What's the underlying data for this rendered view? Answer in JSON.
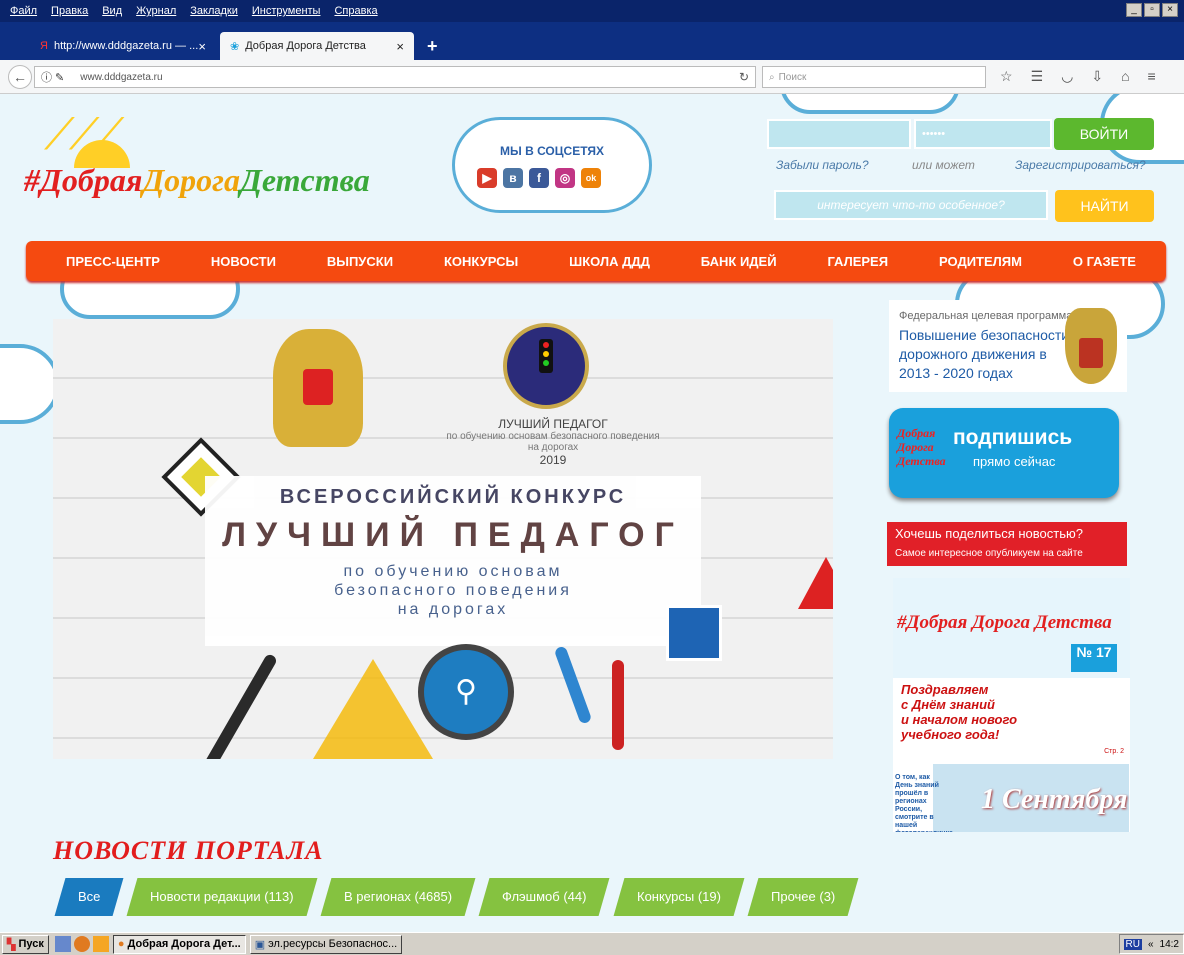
{
  "browser_menu": [
    "Файл",
    "Правка",
    "Вид",
    "Журнал",
    "Закладки",
    "Инструменты",
    "Справка"
  ],
  "tabs": [
    {
      "label": "http://www.dddgazeta.ru — ...",
      "close": "×"
    },
    {
      "label": "Добрая Дорога Детства",
      "close": "×"
    }
  ],
  "newtab": "+",
  "window_buttons": [
    "_",
    "▫",
    "×"
  ],
  "url": "www.dddgazeta.ru",
  "browser_search_placeholder": "Поиск",
  "site": {
    "logo_text": {
      "p1": "#Добрая",
      "p2": "Дорога",
      "p3": "Детства"
    },
    "social_title": "МЫ В СОЦСЕТЯХ",
    "social_icons": [
      {
        "name": "youtube-icon",
        "glyph": "▶",
        "color": "#d93c2a"
      },
      {
        "name": "vk-icon",
        "glyph": "в",
        "color": "#4c75a3"
      },
      {
        "name": "facebook-icon",
        "glyph": "f",
        "color": "#3b5998"
      },
      {
        "name": "instagram-icon",
        "glyph": "◎",
        "color": "#c13584"
      },
      {
        "name": "odnoklassniki-icon",
        "glyph": "ok",
        "color": "#ee8208"
      }
    ],
    "login": {
      "password_mask": "••••••",
      "login_button": "ВОЙТИ",
      "forgot": "Забыли пароль?",
      "or": "или может",
      "register": "Зарегистрироваться?",
      "search_placeholder": "интересует что-то особенное?",
      "search_button": "НАЙТИ"
    },
    "nav": [
      "ПРЕСС-ЦЕНТР",
      "НОВОСТИ",
      "ВЫПУСКИ",
      "КОНКУРСЫ",
      "ШКОЛА ДДД",
      "БАНК ИДЕЙ",
      "ГАЛЕРЕЯ",
      "РОДИТЕЛЯМ",
      "О ГАЗЕТЕ"
    ],
    "banner": {
      "logo_caption": "ЛУЧШИЙ ПЕДАГОГ",
      "logo_sub": "по обучению основам безопасного поведения на дорогах",
      "year": "2019",
      "line1": "ВСЕРОССИЙСКИЙ КОНКУРС",
      "line2": "ЛУЧШИЙ ПЕДАГОГ",
      "line3": "по обучению основам",
      "line4": "безопасного поведения",
      "line5": "на дорогах"
    },
    "fcp": {
      "small": "Федеральная целевая программа",
      "title1": "Повышение безопасности",
      "title2": "дорожного движения в",
      "title3": "2013 - 2020 годах"
    },
    "subscribe": {
      "big": "подпишись",
      "small": "прямо сейчас",
      "mini": "Добрая Дорога Детства"
    },
    "share": {
      "title": "Хочешь поделиться новостью?",
      "sub": "Самое интересное опубликуем на сайте"
    },
    "paper": {
      "title": "#Добрая Дорога Детства",
      "num": "№ 17",
      "greeting1": "Поздравляем",
      "greeting2": "с Днём знаний",
      "greeting3": "и началом нового",
      "greeting4": "учебного года!",
      "sept": "1 Сентября",
      "side_text": "О том, как День знаний прошёл в регионах России, смотрите в нашей фотоперекличке",
      "page": "Стр. 2"
    },
    "news_title": "НОВОСТИ ПОРТАЛА",
    "filters": [
      "Все",
      "Новости редакции (113)",
      "В регионах (4685)",
      "Флэшмоб (44)",
      "Конкурсы (19)",
      "Прочее (3)"
    ]
  },
  "taskbar": {
    "start": "Пуск",
    "tasks": [
      "Добрая Дорога Дет...",
      "эл.ресурсы Безопаснос..."
    ],
    "lang": "RU",
    "time": "14:2"
  }
}
